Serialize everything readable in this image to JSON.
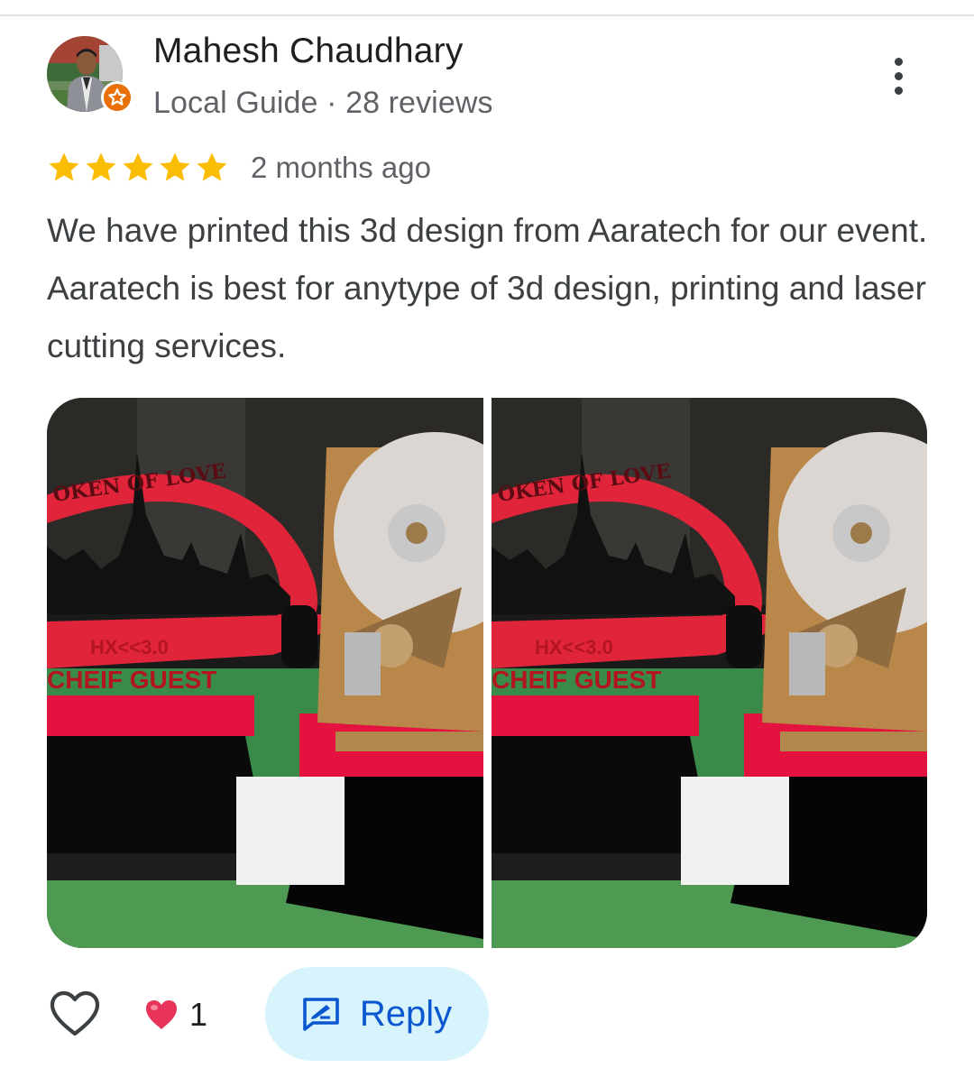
{
  "review": {
    "reviewer": {
      "name": "Mahesh Chaudhary",
      "meta": "Local Guide · 28 reviews",
      "badge_icon": "local-guide-star-icon"
    },
    "rating": {
      "stars": 5,
      "max": 5,
      "star_color": "#fbbc04"
    },
    "time": "2 months ago",
    "text": "We have printed this 3d design from Aaratech for our event. Aaratech is best for anytype of 3d design, printing and laser cutting services.",
    "photos": [
      {
        "icon": "trophy-photo",
        "trophy_arc_text": "OKEN OF LOVE",
        "trophy_logo_text": "HX<<3.0",
        "trophy_title": "CHEIF GUEST"
      },
      {
        "icon": "trophy-photo",
        "trophy_arc_text": "OKEN OF LOVE",
        "trophy_logo_text": "HX<<3.0",
        "trophy_title": "CHEIF GUEST"
      }
    ]
  },
  "actions": {
    "like_icon": "heart-outline-icon",
    "reaction_icon": "heart-filled-icon",
    "reaction_count": "1",
    "reply_label": "Reply",
    "reply_icon": "reply-icon",
    "more_icon": "more-vert-icon"
  },
  "colors": {
    "name": "#1f1f1f",
    "secondary_text": "#5f6368",
    "body_text": "#3c4043",
    "reply_bg": "#d7f3fb",
    "reply_text": "#0b57d0",
    "badge": "#e8710a",
    "heart": "#e8345a"
  }
}
